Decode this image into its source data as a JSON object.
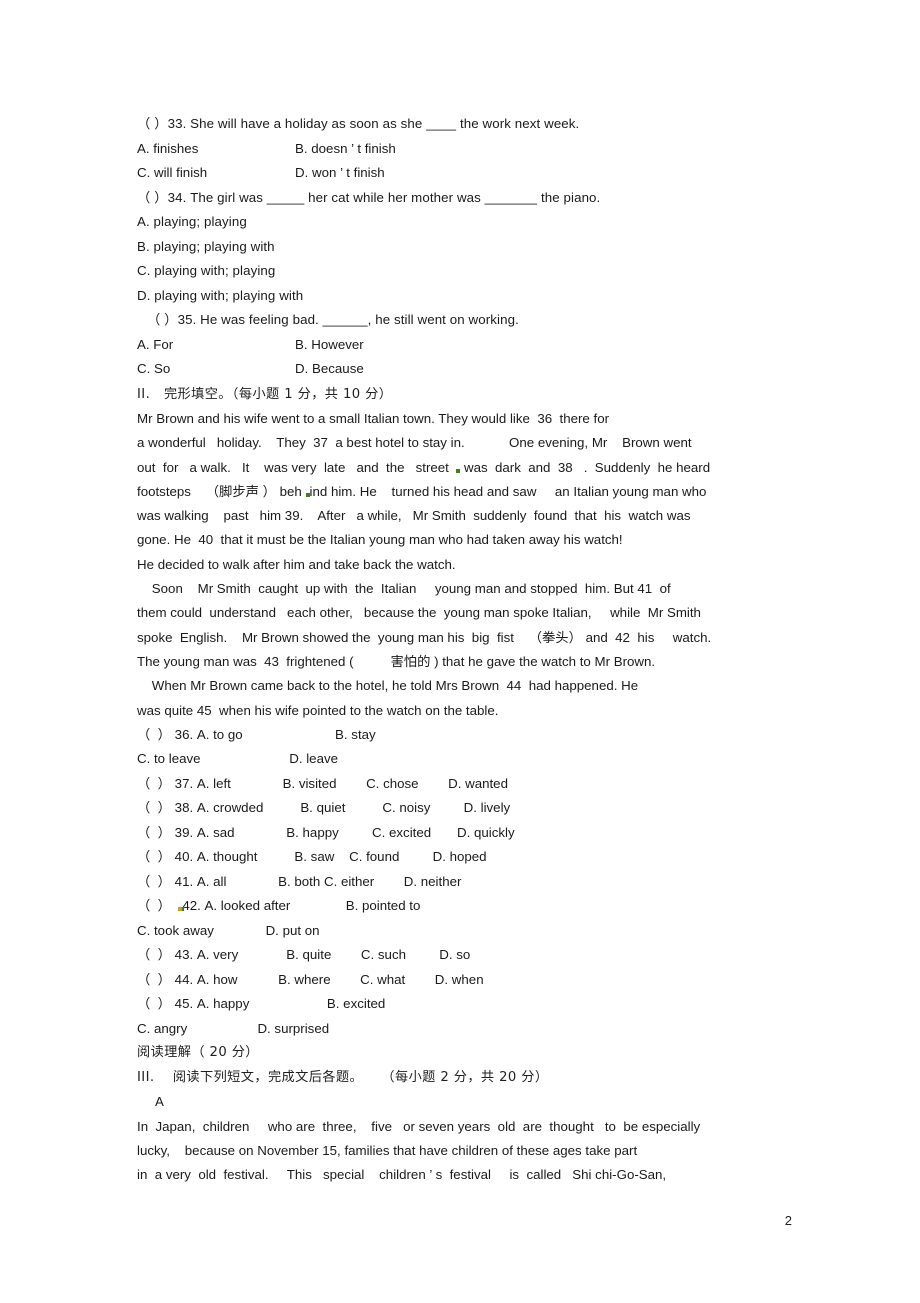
{
  "document": {
    "page_number": "2",
    "language": "English exam paper (Chinese instructions)"
  },
  "multiple_choice_tail": {
    "q33": {
      "stem": "（ ）33. She will have a holiday as soon as she ____ the work next week.",
      "options": [
        {
          "left": "A. finishes",
          "right": "B. doesn ’ t finish"
        },
        {
          "left": "C. will finish",
          "right": "D. won ’ t finish"
        }
      ]
    },
    "q34": {
      "stem": "（ ）34. The girl was _____ her cat while her mother was _______ the piano.",
      "options": [
        "A. playing; playing",
        "B. playing; playing with",
        "C. playing with; playing",
        "D. playing with; playing with"
      ]
    },
    "q35": {
      "stem": "（ ）35. He was feeling bad. ______, he still went on working.",
      "options": [
        {
          "left": "A. For",
          "right": "B. However"
        },
        {
          "left": "C. So",
          "right": "D. Because"
        }
      ]
    }
  },
  "section_2": {
    "heading": "ⅠⅠ.   完形填空。（每小题 1 分，共 10 分）",
    "passage_lines": [
      "Mr Brown and his wife went to a small Italian town. They would like  36  there for",
      "a wonderful   holiday.    They  37  a best hotel to stay in.            One evening, Mr    Brown went",
      "out  for   a walk.   It    was very  late   and  the   street  @GREEN@ was  dark  and  38   .  Suddenly  he heard",
      "footsteps    （脚步声 ） beh @GREEN@ind him. He    turned his head and saw     an Italian young man who",
      "was walking    past   him 39.    After   a while,   Mr Smith  suddenly  found  that  his  watch was",
      "gone. He  40  that it must be the Italian young man who had taken away his watch!",
      "He decided to walk after him and take back the watch.",
      "    Soon    Mr Smith  caught  up with  the  Italian     young man and stopped  him. But 41  of",
      "them could  understand   each other,   because the  young man spoke Italian,     while  Mr Smith",
      "spoke  English.    Mr Brown showed the  young man his  big  fist    （拳头） and  42  his     watch.",
      "The young man was  43  frightened (          害怕的 ) that he gave the watch to Mr Brown.",
      "    When Mr Brown came back to the hotel, he told Mrs Brown  44  had happened. He",
      "was quite 45  when his wife pointed to the watch on the table."
    ],
    "answer_bank": [
      {
        "number": "36",
        "prefix": "（  ） 36. A. to go",
        "wrapped": true,
        "line1": "（  ） 36. A. to go                         B. stay",
        "line2": "C. to leave                        D. leave"
      },
      {
        "number": "37",
        "wrapped": false,
        "line1": "（  ） 37. A. left              B. visited        C. chose        D. wanted"
      },
      {
        "number": "38",
        "wrapped": false,
        "line1": "（  ） 38. A. crowded          B. quiet          C. noisy         D. lively"
      },
      {
        "number": "39",
        "wrapped": false,
        "line1": "（  ） 39. A. sad              B. happy         C. excited       D. quickly"
      },
      {
        "number": "40",
        "wrapped": false,
        "line1": "（  ） 40. A. thought          B. saw    C. found         D. hoped"
      },
      {
        "number": "41",
        "wrapped": false,
        "line1": "（  ） 41. A. all              B. both C. either        D. neither"
      },
      {
        "number": "42",
        "wrapped": true,
        "line1": "（  ）  @YELLOW@42. A. looked after               B. pointed to",
        "line2": "C. took away              D. put on"
      },
      {
        "number": "43",
        "wrapped": false,
        "line1": "（  ） 43. A. very             B. quite        C. such         D. so"
      },
      {
        "number": "44",
        "wrapped": false,
        "line1": "（  ） 44. A. how           B. where        C. what        D. when"
      },
      {
        "number": "45",
        "wrapped": true,
        "line1": "（  ） 45. A. happy                     B. excited",
        "line2": "C. angry                   D. surprised"
      }
    ]
  },
  "section_3": {
    "title": "阅读理解（ 20 分）",
    "heading": "ⅠⅠⅠ.    阅读下列短文，完成文后各题。    （每小题 2 分，共 20 分）",
    "passage_label": "A",
    "passage_lines": [
      "In  Japan,  children     who are  three,    five   or seven years  old  are  thought   to  be especially",
      "lucky,    because on November 15, families that have children of these ages take part",
      "in  a very  old  festival.     This   special    children ’ s  festival     is  called   Shi chi-Go-San,"
    ]
  }
}
